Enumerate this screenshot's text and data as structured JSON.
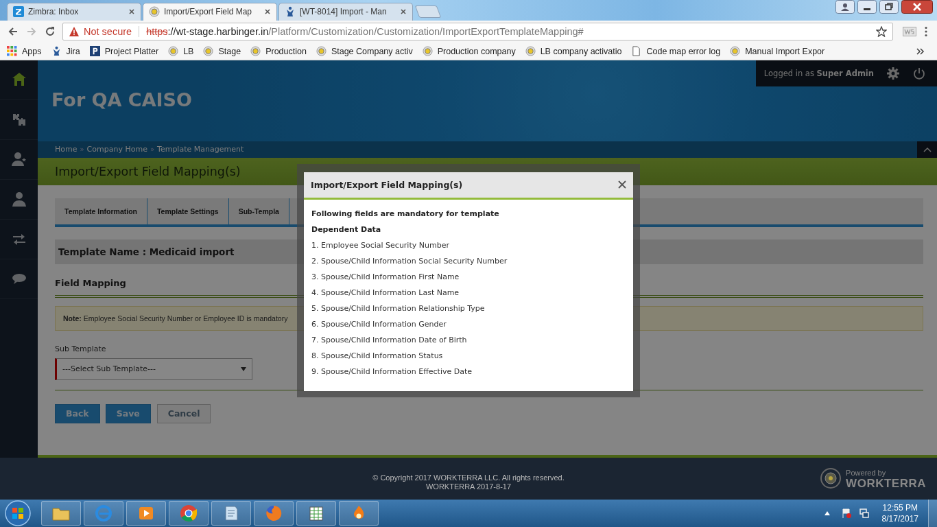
{
  "browser": {
    "tabs": [
      {
        "title": "Zimbra: Inbox",
        "kind": "zimbra",
        "selected": false
      },
      {
        "title": "Import/Export Field Map",
        "kind": "site",
        "selected": true
      },
      {
        "title": "[WT-8014] Import - Man",
        "kind": "jira",
        "selected": false
      }
    ],
    "security": "Not secure",
    "url_scheme": "https",
    "url_rest": "://wt-stage.harbinger.in",
    "url_path": "/Platform/Customization/Customization/ImportExportTemplateMapping#",
    "bookmarks": [
      {
        "label": "Apps",
        "kind": "apps"
      },
      {
        "label": "Jira",
        "kind": "jira"
      },
      {
        "label": "Project Platter",
        "kind": "p"
      },
      {
        "label": "LB",
        "kind": "site"
      },
      {
        "label": "Stage",
        "kind": "site"
      },
      {
        "label": "Production",
        "kind": "site"
      },
      {
        "label": "Stage Company activ",
        "kind": "site"
      },
      {
        "label": "Production company",
        "kind": "site"
      },
      {
        "label": "LB company activatio",
        "kind": "site"
      },
      {
        "label": "Code map error log",
        "kind": "page"
      },
      {
        "label": "Manual Import Expor",
        "kind": "site"
      }
    ]
  },
  "sidebar": {
    "items": [
      {
        "kind": "home",
        "selected": true
      },
      {
        "kind": "puzzle",
        "selected": false
      },
      {
        "kind": "user-star",
        "selected": false
      },
      {
        "kind": "user",
        "selected": false
      },
      {
        "kind": "arrows",
        "selected": false
      },
      {
        "kind": "chat",
        "selected": false
      }
    ]
  },
  "header": {
    "company": "For QA CAISO",
    "login_prefix": "Logged in as",
    "user": "Super Admin"
  },
  "breadcrumb": {
    "separator": "»",
    "items": [
      "Home",
      "Company Home",
      "Template Management"
    ]
  },
  "page_title": "Import/Export Field Mapping(s)",
  "tabs": [
    "Template Information",
    "Template Settings",
    "Sub-Templa"
  ],
  "template_name": "Template Name : Medicaid import",
  "section_title": "Field Mapping",
  "note": "**Note:** Employee Social Security Number or Employee ID is mandatory",
  "sub_template": {
    "label": "Sub Template",
    "value": "---Select Sub Template---",
    "required": true
  },
  "buttons": [
    {
      "label": "Back",
      "kind": "primary"
    },
    {
      "label": "Save",
      "kind": "primary"
    },
    {
      "label": "Cancel",
      "kind": "secondary"
    }
  ],
  "modal": {
    "title": "Import/Export Field Mapping(s)",
    "intro": "Following fields are mandatory for template",
    "group": "Dependent Data",
    "items": [
      "1. Employee Social Security Number",
      "2. Spouse/Child Information Social Security Number",
      "3. Spouse/Child Information First Name",
      "4. Spouse/Child Information Last Name",
      "5. Spouse/Child Information Relationship Type",
      "6. Spouse/Child Information Gender",
      "7. Spouse/Child Information Date of Birth",
      "8. Spouse/Child Information Status",
      "9. Spouse/Child Information Effective Date"
    ]
  },
  "footer": {
    "copyright": "© Copyright 2017 WORKTERRA LLC. All rights reserved.",
    "version": "WORKTERRA 2017-8-17",
    "powered_by": "Powered by",
    "brand": "WORKTERRA"
  },
  "taskbar": {
    "apps": [
      {
        "kind": "folder"
      },
      {
        "kind": "ie"
      },
      {
        "kind": "media"
      },
      {
        "kind": "chrome"
      },
      {
        "kind": "notepad"
      },
      {
        "kind": "firefox"
      },
      {
        "kind": "spreadsheet"
      },
      {
        "kind": "flame"
      }
    ],
    "time": "12:55 PM",
    "date": "8/17/2017"
  }
}
